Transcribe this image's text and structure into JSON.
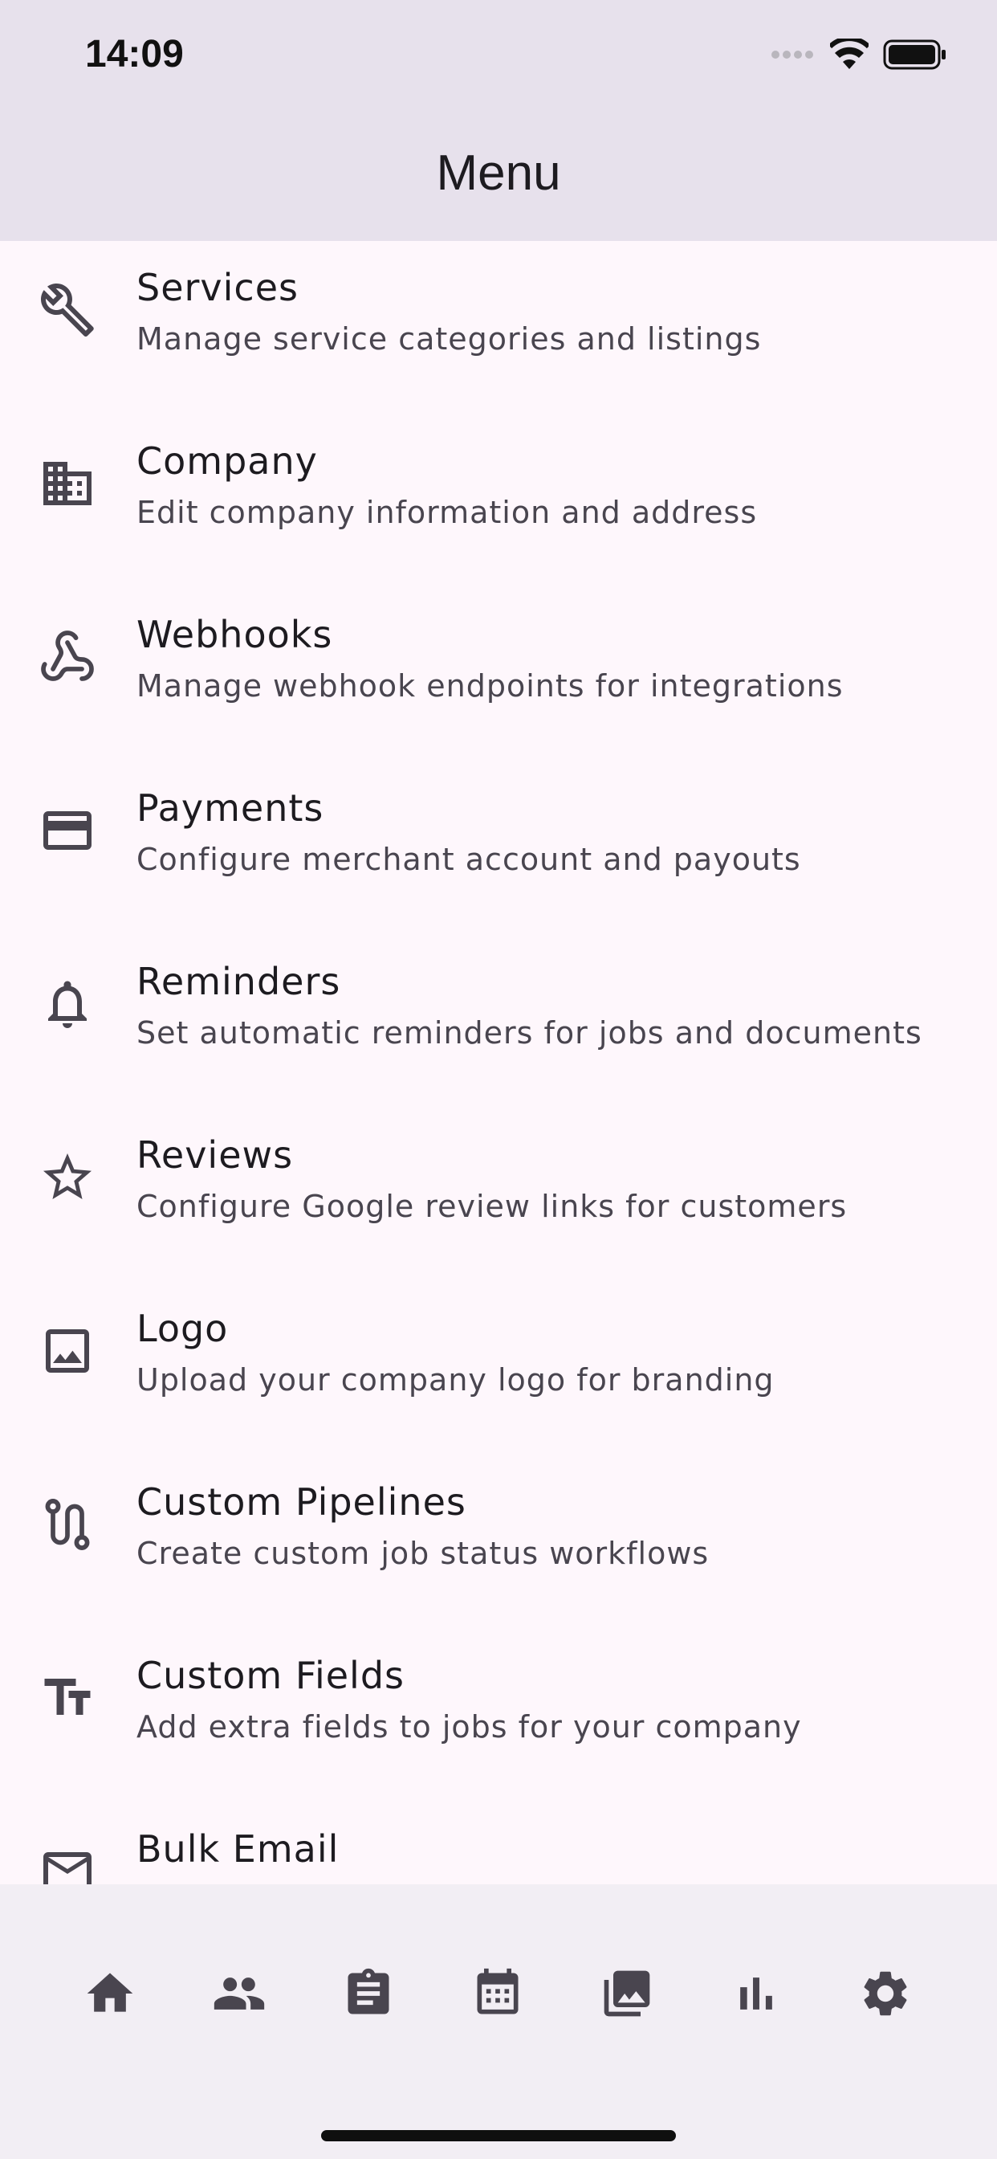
{
  "status_bar": {
    "time": "14:09"
  },
  "header": {
    "title": "Menu"
  },
  "menu": {
    "items": [
      {
        "title": "Services",
        "subtitle": "Manage service categories and listings",
        "icon": "wrench-icon"
      },
      {
        "title": "Company",
        "subtitle": "Edit company information and address",
        "icon": "building-icon"
      },
      {
        "title": "Webhooks",
        "subtitle": "Manage webhook endpoints for integrations",
        "icon": "webhook-icon"
      },
      {
        "title": "Payments",
        "subtitle": "Configure merchant account and payouts",
        "icon": "credit-card-icon"
      },
      {
        "title": "Reminders",
        "subtitle": "Set automatic reminders for jobs and documents",
        "icon": "bell-icon"
      },
      {
        "title": "Reviews",
        "subtitle": "Configure Google review links for customers",
        "icon": "star-icon"
      },
      {
        "title": "Logo",
        "subtitle": "Upload your company logo for branding",
        "icon": "image-icon"
      },
      {
        "title": "Custom Pipelines",
        "subtitle": "Create custom job status workflows",
        "icon": "route-icon"
      },
      {
        "title": "Custom Fields",
        "subtitle": "Add extra fields to jobs for your company",
        "icon": "text-fields-icon"
      },
      {
        "title": "Bulk Email",
        "subtitle": "",
        "icon": "mail-icon"
      }
    ]
  },
  "bottom_nav": {
    "items": [
      {
        "icon": "home-icon"
      },
      {
        "icon": "people-icon"
      },
      {
        "icon": "clipboard-icon"
      },
      {
        "icon": "calendar-icon"
      },
      {
        "icon": "photos-icon"
      },
      {
        "icon": "bar-chart-icon"
      },
      {
        "icon": "settings-icon"
      }
    ]
  },
  "colors": {
    "header_bg": "#e7e1ec",
    "list_bg": "#fef7fc",
    "nav_bg": "#f2eef4",
    "icon": "#49454f",
    "title_text": "#1d1b20",
    "subtitle_text": "#49454f"
  }
}
